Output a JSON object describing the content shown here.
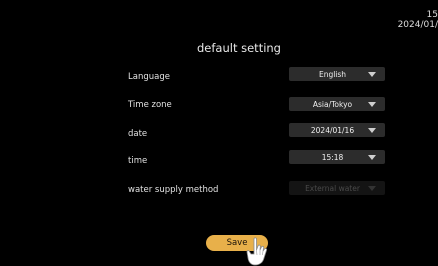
{
  "status": {
    "time": "15",
    "date": "2024/01/"
  },
  "page": {
    "title": "default setting"
  },
  "settings": [
    {
      "label": "Language",
      "value": "English",
      "enabled": true
    },
    {
      "label": "Time zone",
      "value": "Asia/Tokyo",
      "enabled": true
    },
    {
      "label": "date",
      "value": "2024/01/16",
      "enabled": true
    },
    {
      "label": "time",
      "value": "15:18",
      "enabled": true
    },
    {
      "label": "water supply method",
      "value": "External water",
      "enabled": false
    }
  ],
  "actions": {
    "save_label": "Save"
  },
  "icons": {
    "dropdown": "chevron-down-icon",
    "pointer": "hand-pointer-icon"
  },
  "colors": {
    "background": "#000000",
    "dropdown_bg": "#2c2c2c",
    "save_button": "#e8b04a"
  }
}
